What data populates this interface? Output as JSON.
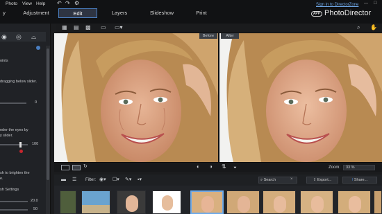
{
  "menu": {
    "items": [
      "Photo",
      "View",
      "Help"
    ]
  },
  "tabs": [
    {
      "label": "y"
    },
    {
      "label": "Adjustment"
    },
    {
      "label": "Edit"
    },
    {
      "label": "Layers"
    },
    {
      "label": "Slideshow"
    },
    {
      "label": "Print"
    }
  ],
  "header": {
    "signin": "Sign in to DirectorZone",
    "app_badge": "APP",
    "brand": "PhotoDirector"
  },
  "left_panel": {
    "texts": [
      "oints",
      "dragging below slider.",
      "0",
      "nder the eyes by",
      "y slider.",
      "100",
      "sh to brighten the",
      "e.",
      "sh Settings",
      "20.0",
      "50"
    ]
  },
  "compare": {
    "before": "Before",
    "after": "After"
  },
  "zoom": {
    "label": "Zoom:",
    "value": "33 %"
  },
  "filter": {
    "label": "Filter:"
  },
  "search": {
    "placeholder": "Search"
  },
  "actions": {
    "export": "Export...",
    "share": "Share..."
  },
  "colors": {
    "accent": "#4a7ec0",
    "link": "#6fa7e6"
  }
}
